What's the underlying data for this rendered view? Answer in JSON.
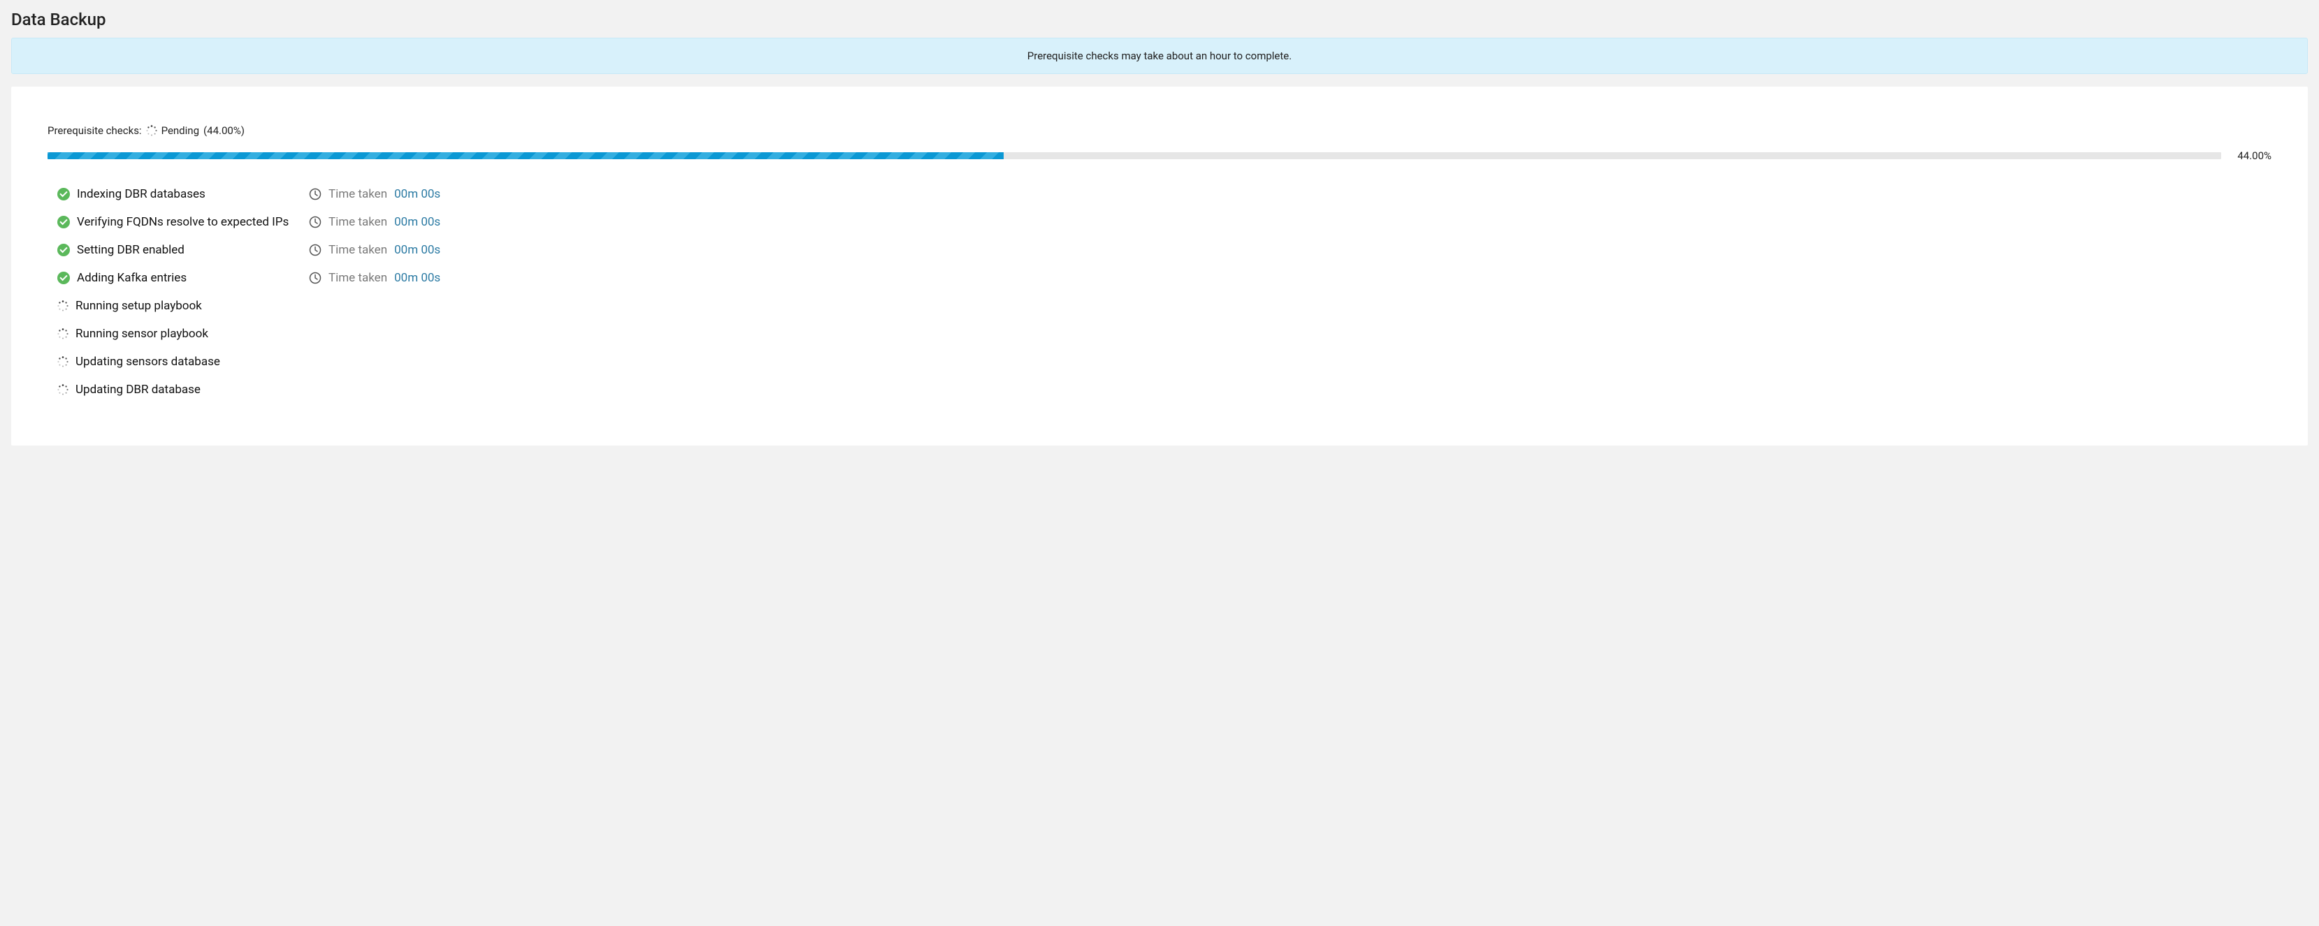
{
  "page_title": "Data Backup",
  "banner_text": "Prerequisite checks may take about an hour to complete.",
  "status": {
    "prefix": "Prerequisite checks:",
    "state_label": "Pending",
    "percent_text": "(44.00%)",
    "progress_percent": 44,
    "progress_display": "44.00%"
  },
  "time_taken_label": "Time taken",
  "checks": [
    {
      "label": "Indexing DBR databases",
      "state": "done",
      "time": "00m 00s"
    },
    {
      "label": "Verifying FQDNs resolve to expected IPs",
      "state": "done",
      "time": "00m 00s"
    },
    {
      "label": "Setting DBR enabled",
      "state": "done",
      "time": "00m 00s"
    },
    {
      "label": "Adding Kafka entries",
      "state": "done",
      "time": "00m 00s"
    },
    {
      "label": "Running setup playbook",
      "state": "pending",
      "time": ""
    },
    {
      "label": "Running sensor playbook",
      "state": "pending",
      "time": ""
    },
    {
      "label": "Updating sensors database",
      "state": "pending",
      "time": ""
    },
    {
      "label": "Updating DBR database",
      "state": "pending",
      "time": ""
    }
  ]
}
